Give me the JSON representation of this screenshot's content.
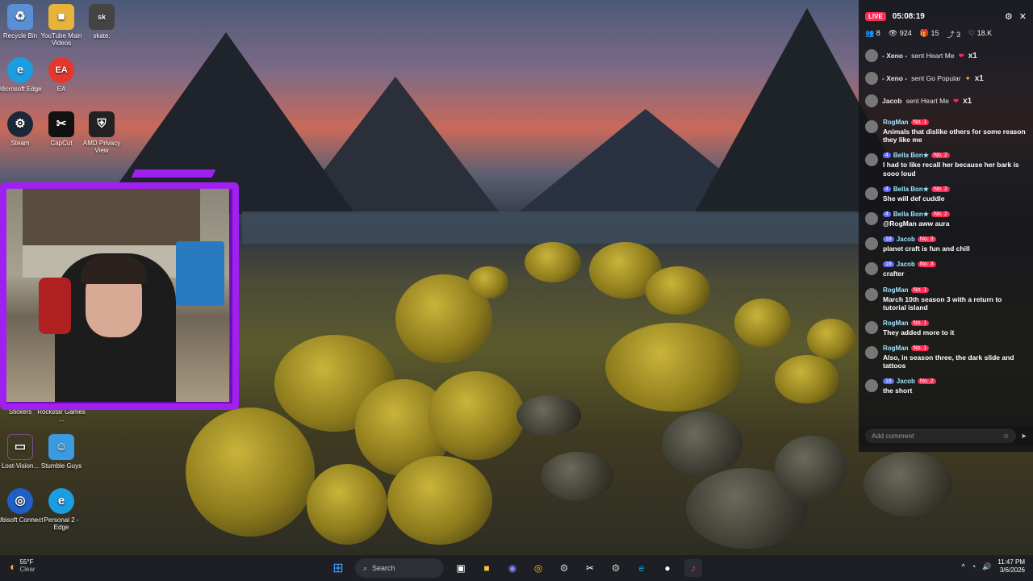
{
  "desktop": {
    "icons": [
      {
        "label": "Recycle Bin",
        "icon": "recycle-bin-icon",
        "color": "#5a8fd6"
      },
      {
        "label": "YouTube Main Videos",
        "icon": "folder-icon",
        "color": "#e8b33a"
      },
      {
        "label": "skate.",
        "icon": "skate-icon",
        "color": "#444444"
      },
      {
        "label": "Microsoft Edge",
        "icon": "edge-icon",
        "color": "#1b9de2"
      },
      {
        "label": "EA",
        "icon": "ea-icon",
        "color": "#e4372d"
      },
      {
        "label": "Steam",
        "icon": "steam-icon",
        "color": "#1b2838"
      },
      {
        "label": "CapCut",
        "icon": "capcut-icon",
        "color": "#111111"
      },
      {
        "label": "AMD Privacy View",
        "icon": "amd-privacy-icon",
        "color": "#222222"
      },
      {
        "label": "Stickers",
        "icon": "stickers-icon",
        "color": "#666666"
      },
      {
        "label": "Rockstar Games ...",
        "icon": "rockstar-icon",
        "color": "#f6a800"
      },
      {
        "label": "Lost-Vision...",
        "icon": "lost-vision-icon",
        "color": "#6a3d7a"
      },
      {
        "label": "Stumble Guys",
        "icon": "stumble-guys-icon",
        "color": "#3a9be0"
      },
      {
        "label": "Ubisoft Connect",
        "icon": "ubisoft-icon",
        "color": "#1f60c4"
      },
      {
        "label": "Personal 2 - Edge",
        "icon": "edge-icon",
        "color": "#1b9de2"
      }
    ]
  },
  "chat": {
    "live": "LIVE",
    "timer": "05:08:19",
    "stats": {
      "viewers": "8",
      "views": "924",
      "gifts": "15",
      "shares": "3",
      "likes": "18.K"
    },
    "gifts": [
      {
        "user": "- Xeno -",
        "action": "sent Heart Me",
        "count": "x1"
      },
      {
        "user": "- Xeno -",
        "action": "sent Go Popular",
        "count": "x1"
      },
      {
        "user": "Jacob",
        "action": "sent Heart Me",
        "count": "x1"
      }
    ],
    "messages": [
      {
        "name": "RogMan",
        "level": "",
        "rank": "No. 1",
        "text": "Animals that dislike others for some reason they like me"
      },
      {
        "name": "Bella Bon★",
        "level": "4",
        "rank": "No. 2",
        "text": "I had to like recall her because her bark is sooo loud"
      },
      {
        "name": "Bella Bon★",
        "level": "4",
        "rank": "No. 2",
        "text": "She will def cuddle"
      },
      {
        "name": "Bella Bon★",
        "level": "4",
        "rank": "No. 2",
        "text": "@RogMan aww aura"
      },
      {
        "name": "Jacob",
        "level": "18",
        "rank": "No. 3",
        "text": "planet craft is fun and chill"
      },
      {
        "name": "Jacob",
        "level": "18",
        "rank": "No. 3",
        "text": "crafter"
      },
      {
        "name": "RogMan",
        "level": "",
        "rank": "No. 1",
        "text": "March 10th season 3 with a return to tutorial island"
      },
      {
        "name": "RogMan",
        "level": "",
        "rank": "No. 1",
        "text": "They added more to it"
      },
      {
        "name": "RogMan",
        "level": "",
        "rank": "No. 1",
        "text": "Also, in season three, the dark slide and tattoos"
      },
      {
        "name": "Jacob",
        "level": "18",
        "rank": "No. 2",
        "text": "the short"
      }
    ],
    "comment_placeholder": "Add comment"
  },
  "taskbar": {
    "weather_temp": "55°F",
    "weather_desc": "Clear",
    "search_placeholder": "Search",
    "time": "11:47 PM",
    "date": "3/6/2026"
  },
  "colors": {
    "accent": "#fe2c55",
    "cam_border": "#a020f0",
    "taskbar": "#1d1f24"
  }
}
